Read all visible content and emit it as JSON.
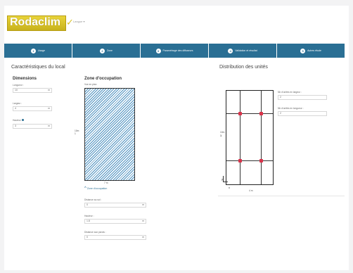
{
  "header": {
    "logo_text": "Rodaclim",
    "language": "Langue ▾"
  },
  "steps": [
    {
      "num": "1",
      "label": "Usage"
    },
    {
      "num": "2",
      "label": "Zone"
    },
    {
      "num": "3",
      "label": "Paramétrage des diffuseurs"
    },
    {
      "num": "4",
      "label": "Validation et résultat"
    },
    {
      "num": "5",
      "label": "Autres étude"
    }
  ],
  "local": {
    "heading": "Caractéristiques du local",
    "dimensions": {
      "heading": "Dimensions",
      "longueur_label": "Longueur :",
      "longueur_value": "10",
      "longueur_unit": "m",
      "largeur_label": "Largeur :",
      "largeur_value": "4",
      "largeur_unit": "m",
      "hauteur_label": "Hauteur",
      "hauteur_value": "3",
      "hauteur_unit": "m"
    },
    "zone": {
      "heading": "Zone d'occupation",
      "view_label": "Vue en plan",
      "side_label": "10m\n1",
      "bottom_label": "7 m",
      "toggle_label": "Zone d'occupation",
      "fields": [
        {
          "label": "Distance au sol :",
          "value": "0",
          "unit": "m"
        },
        {
          "label": "Hauteur :",
          "value": "1.8",
          "unit": "m"
        },
        {
          "label": "Distance aux parois :",
          "value": "0",
          "unit": "m"
        }
      ]
    }
  },
  "distribution": {
    "heading": "Distribution des unités",
    "per_width_label": "Nb d'unités en largeur :",
    "per_width_value": "2",
    "per_length_label": "Nb d'unités en longueur :",
    "per_length_value": "2",
    "side_label": "10m",
    "side_num": "1",
    "bottom_label": "4 m",
    "axis_y": "y",
    "axis_x": "x",
    "point_color": "#d9334a"
  },
  "colors": {
    "nav_bar": "#2a6f94",
    "hatch": "#4a8fbf",
    "logo": "#d9c22a"
  }
}
